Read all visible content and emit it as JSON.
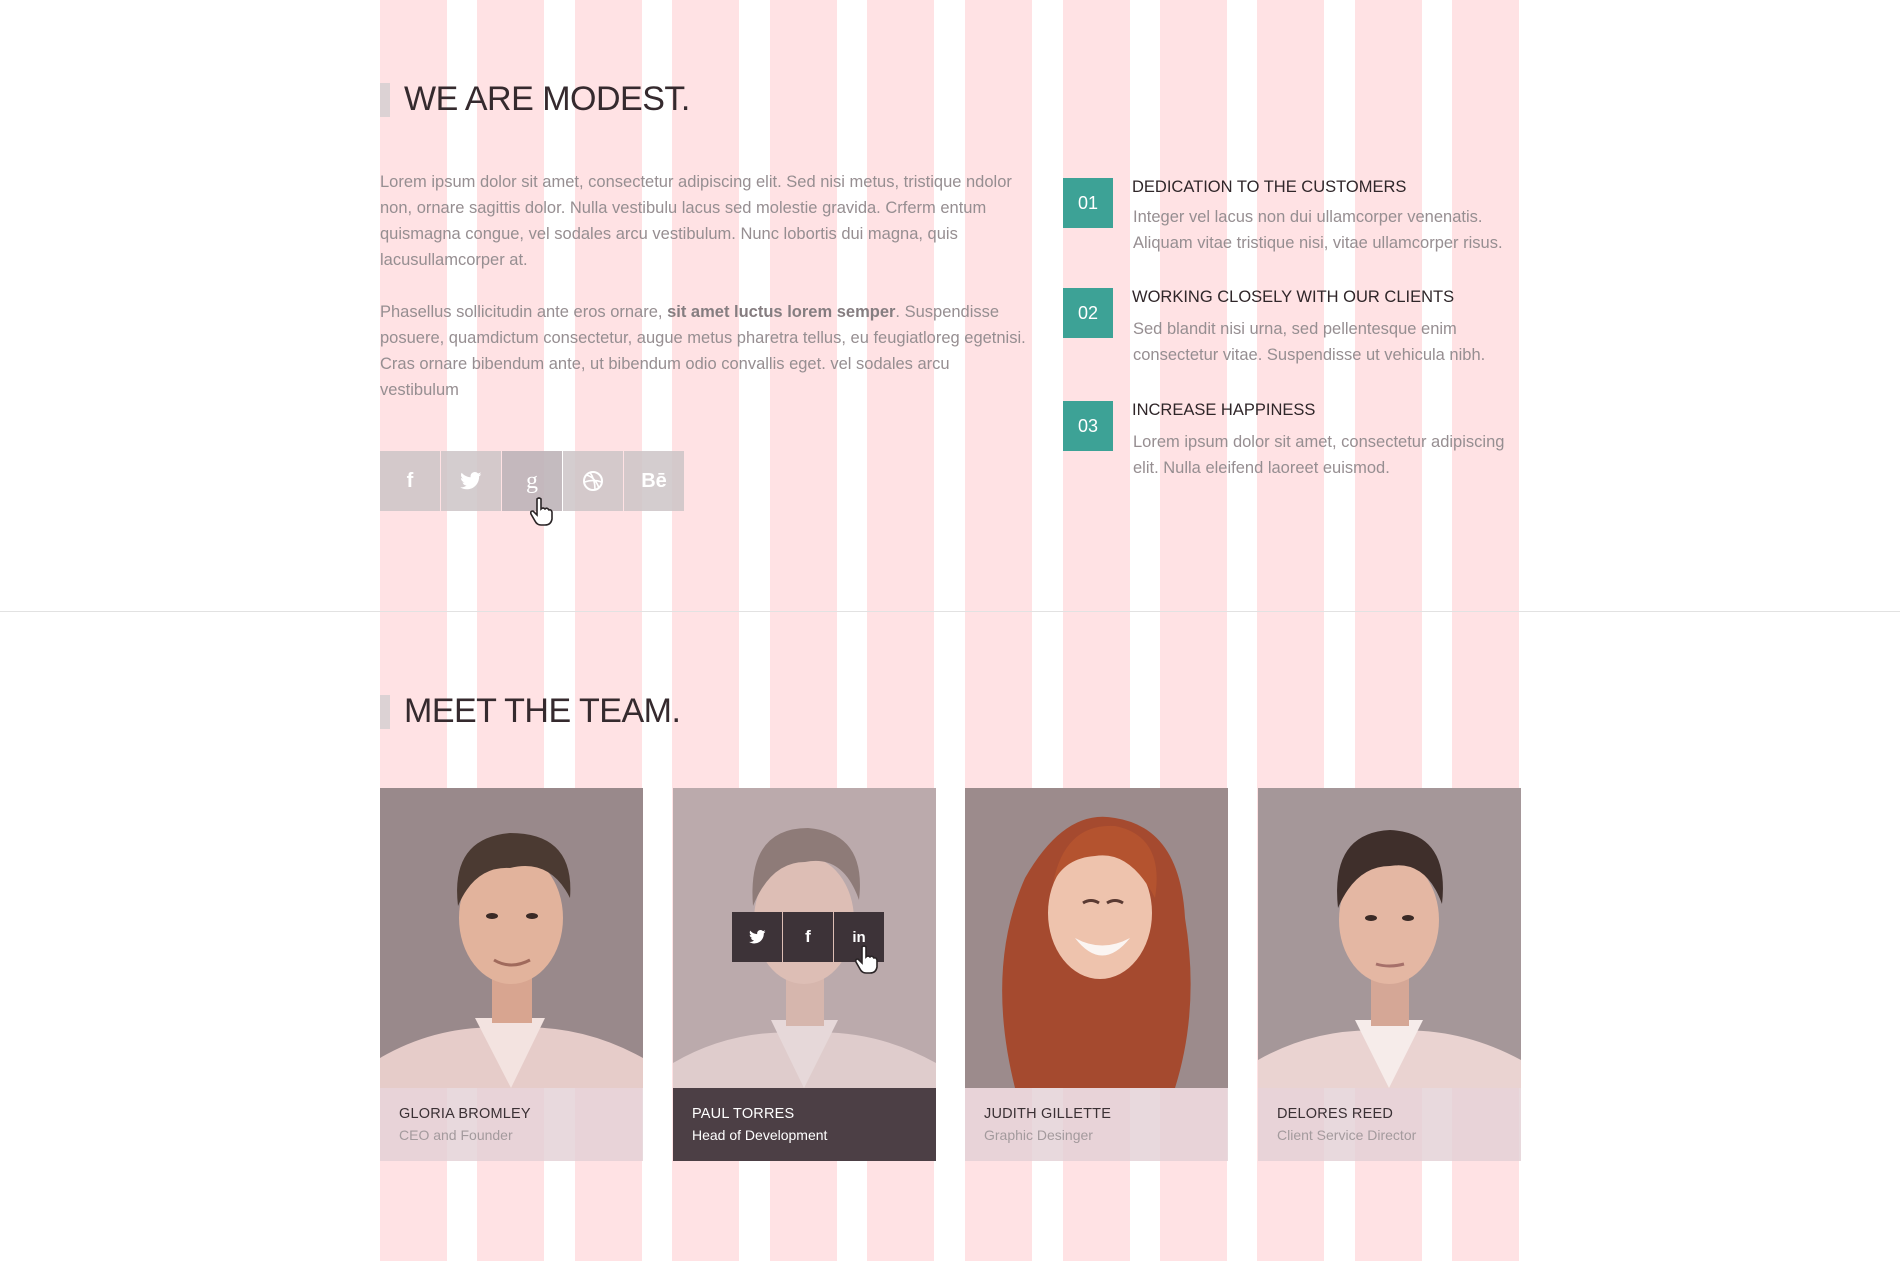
{
  "about": {
    "heading": "WE ARE MODEST.",
    "paragraph1": "Lorem ipsum dolor sit amet, consectetur adipiscing elit. Sed nisi metus, tristique ndolor non, ornare sagittis dolor. Nulla vestibulu lacus sed molestie gravida. Crferm entum quismagna congue, vel sodales arcu vestibulum. Nunc lobortis dui magna, quis lacusullamcorper at.",
    "paragraph2_start": "Phasellus sollicitudin ante eros ornare, ",
    "paragraph2_bold": "sit amet luctus lorem semper",
    "paragraph2_end": ". Suspendisse posuere, quamdictum consectetur, augue metus pharetra tellus, eu feugiatloreg egetnisi. Cras ornare bibendum ante, ut bibendum odio convallis eget. vel sodales arcu vestibulum",
    "social": [
      {
        "icon": "facebook-icon",
        "glyph": "f"
      },
      {
        "icon": "twitter-icon",
        "glyph": ""
      },
      {
        "icon": "google-icon",
        "glyph": "g"
      },
      {
        "icon": "dribbble-icon",
        "glyph": ""
      },
      {
        "icon": "behance-icon",
        "glyph": "Bē"
      }
    ]
  },
  "features": [
    {
      "number": "01",
      "title": "DEDICATION TO THE CUSTOMERS",
      "desc": "Integer vel lacus non dui ullamcorper venenatis. Aliquam vitae tristique nisi, vitae ullamcorper risus."
    },
    {
      "number": "02",
      "title": "WORKING CLOSELY WITH OUR CLIENTS",
      "desc": "Sed blandit nisi urna, sed pellentesque enim consectetur vitae. Suspendisse ut vehicula nibh."
    },
    {
      "number": "03",
      "title": "INCREASE HAPPINESS",
      "desc": "Lorem ipsum dolor sit amet, consectetur adipiscing elit. Nulla eleifend laoreet euismod."
    }
  ],
  "team": {
    "heading": "MEET THE TEAM.",
    "members": [
      {
        "name": "GLORIA BROMLEY",
        "role": "CEO and Founder"
      },
      {
        "name": "PAUL TORRES",
        "role": "Head of Development"
      },
      {
        "name": "JUDITH GILLETTE",
        "role": "Graphic Desinger"
      },
      {
        "name": "DELORES REED",
        "role": "Client Service Director"
      }
    ],
    "hover_social": [
      {
        "icon": "twitter-icon"
      },
      {
        "icon": "facebook-icon",
        "glyph": "f"
      },
      {
        "icon": "linkedin-icon",
        "glyph": "in"
      }
    ]
  },
  "colors": {
    "accent": "#3da296",
    "heading": "#352a2e",
    "grid_overlay": "#ffd0d4",
    "caption_active": "#4c3f45"
  }
}
